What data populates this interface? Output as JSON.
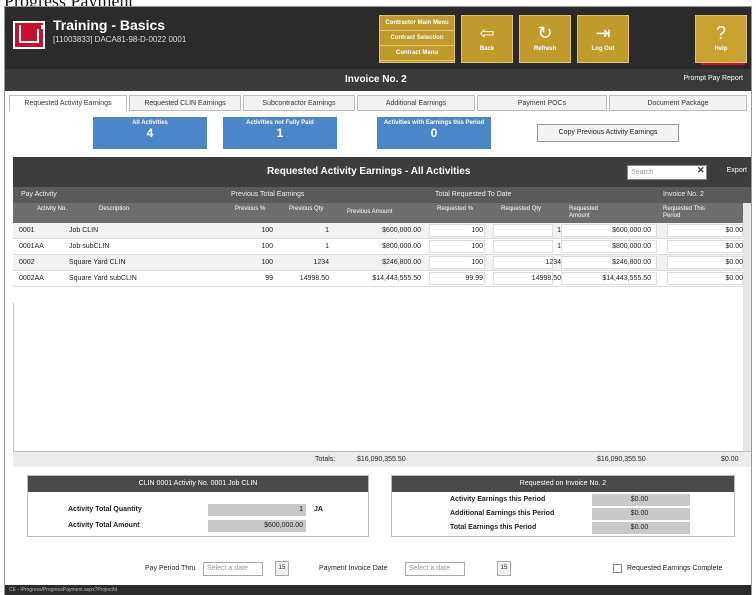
{
  "caption": "Progress Payment",
  "header": {
    "app_title": "Training - Basics",
    "subtitle": "[11003833] DACA81-98-D-0022 0001",
    "menu_items": [
      "Contractor Main Menu",
      "Contract Selection",
      "Contract Menu"
    ],
    "buttons": [
      {
        "label": "Back",
        "icon": "arrow-left-icon",
        "glyph": "⇦"
      },
      {
        "label": "Refresh",
        "icon": "refresh-icon",
        "glyph": "↻"
      },
      {
        "label": "Log Out",
        "icon": "logout-icon",
        "glyph": "⇥"
      },
      {
        "label": "Help",
        "icon": "help-icon",
        "glyph": "?"
      }
    ],
    "accent_color": "#c09a2a",
    "brand_color": "#c8102e"
  },
  "title_bar": {
    "title": "Invoice No. 2",
    "prompt_pay_report": "Prompt Pay Report"
  },
  "tabs": [
    {
      "label": "Requested Activity Earnings",
      "active": true
    },
    {
      "label": "Requested CLIN Earnings",
      "active": false
    },
    {
      "label": "Subcontractor Earnings",
      "active": false
    },
    {
      "label": "Additional Earnings",
      "active": false
    },
    {
      "label": "Payment POCs",
      "active": false
    },
    {
      "label": "Document Package",
      "active": false
    }
  ],
  "tiles": [
    {
      "label": "All Activities",
      "count": "4"
    },
    {
      "label": "Activities not Fully Paid",
      "count": "1"
    },
    {
      "label": "Activities with Earnings this Period",
      "count": "0"
    }
  ],
  "copy_button": "Copy Previous Activity Earnings",
  "grid": {
    "title": "Requested Activity Earnings - All Activities",
    "search_placeholder": "Search",
    "export_label": "Export",
    "group_headers": [
      "Pay Activity",
      "Previous Total Earnings",
      "Total Requested To Date",
      "Invoice No. 2"
    ],
    "columns": [
      "Activity No.",
      "Description",
      "Previous %",
      "Previous Qty",
      "Previous Amount",
      "Requested %",
      "Requested Qty",
      "Requested Amount",
      "Requested This Period"
    ],
    "rows": [
      {
        "activity": "0001",
        "desc": "Job CLIN",
        "prev_pct": "100",
        "prev_qty": "1",
        "prev_amt": "$600,000.00",
        "req_pct": "100",
        "req_qty": "1",
        "req_amt": "$600,000.00",
        "period": "$0.00"
      },
      {
        "activity": "0001AA",
        "desc": "Job subCLIN",
        "prev_pct": "100",
        "prev_qty": "1",
        "prev_amt": "$800,000.00",
        "req_pct": "100",
        "req_qty": "1",
        "req_amt": "$800,000.00",
        "period": "$0.00"
      },
      {
        "activity": "0002",
        "desc": "Square Yard CLIN",
        "prev_pct": "100",
        "prev_qty": "1234",
        "prev_amt": "$246,800.00",
        "req_pct": "100",
        "req_qty": "1234",
        "req_amt": "$246,800.00",
        "period": "$0.00"
      },
      {
        "activity": "0002AA",
        "desc": "Square Yard subCLIN",
        "prev_pct": "99",
        "prev_qty": "14998.50",
        "prev_amt": "$14,443,555.50",
        "req_pct": "99.99",
        "req_qty": "14998.50",
        "req_amt": "$14,443,555.50",
        "period": "$0.00"
      }
    ],
    "totals_label": "Totals:",
    "total_prev": "$16,090,355.50",
    "total_req": "$16,090,355.50",
    "total_period": "$0.00"
  },
  "left_panel": {
    "header": "CLIN 0001   Activity No. 0001   Job CLIN",
    "qty_label": "Activity Total Quantity",
    "qty_value": "1",
    "qty_unit": "JA",
    "amt_label": "Activity Total Amount",
    "amt_value": "$600,000.00"
  },
  "right_panel": {
    "header": "Requested on Invoice No. 2",
    "lines": [
      {
        "label": "Activity Earnings this Period",
        "value": "$0.00"
      },
      {
        "label": "Additional Earnings this Period",
        "value": "$0.00"
      },
      {
        "label": "Total Earnings this Period",
        "value": "$0.00"
      }
    ]
  },
  "footer": {
    "pay_period_label": "Pay Period Thru",
    "pay_period_placeholder": "Select a date",
    "payment_date_label": "Payment Invoice Date",
    "payment_date_placeholder": "Select a date",
    "complete_label": "Requested Earnings Complete",
    "calendar_glyph": "15"
  },
  "status_text": "CE - iProgress/ProgressPayment.aspx?ProjectId"
}
